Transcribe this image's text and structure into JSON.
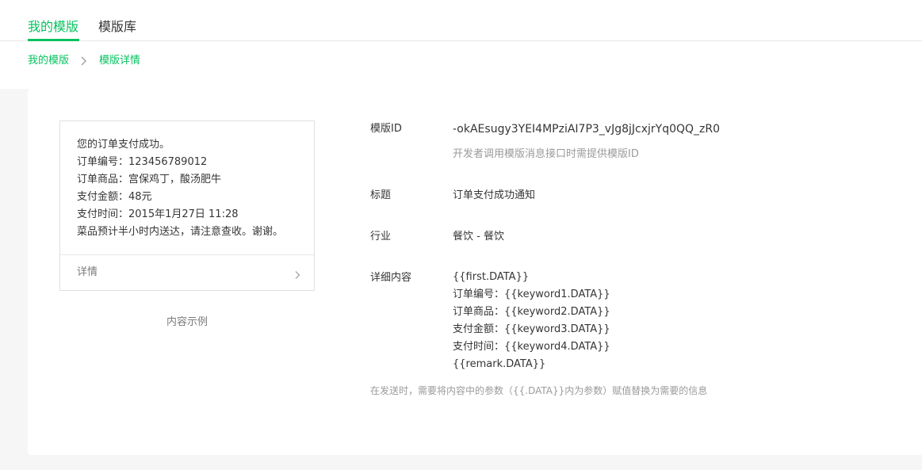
{
  "tabs": [
    {
      "label": "我的模版",
      "active": true
    },
    {
      "label": "模版库",
      "active": false
    }
  ],
  "breadcrumb": {
    "items": [
      "我的模版",
      "模版详情"
    ]
  },
  "preview": {
    "lines": [
      "您的订单支付成功。",
      "订单编号：123456789012",
      "订单商品：宫保鸡丁，酸汤肥牛",
      "支付金额：48元",
      "支付时间：2015年1月27日 11:28",
      "菜品预计半小时内送达，请注意查收。谢谢。"
    ],
    "detail_label": "详情",
    "caption": "内容示例"
  },
  "details": {
    "template_id_label": "模版ID",
    "template_id_value": "-okAEsugy3YEI4MPziAI7P3_vJg8jJcxjrYq0QQ_zR0",
    "template_id_tip": "开发者调用模版消息接口时需提供模版ID",
    "title_label": "标题",
    "title_value": "订单支付成功通知",
    "industry_label": "行业",
    "industry_value": "餐饮 - 餐饮",
    "content_label": "详细内容",
    "content_lines": [
      "{{first.DATA}}",
      "订单编号：{{keyword1.DATA}}",
      "订单商品：{{keyword2.DATA}}",
      "支付金额：{{keyword3.DATA}}",
      "支付时间：{{keyword4.DATA}}",
      "{{remark.DATA}}"
    ],
    "content_tip": "在发送时，需要将内容中的参数（{{.DATA}}内为参数）赋值替换为需要的信息"
  },
  "colors": {
    "accent": "#07c160",
    "text": "#353535",
    "muted": "#9a9a9a",
    "background": "#f6f6f6"
  }
}
